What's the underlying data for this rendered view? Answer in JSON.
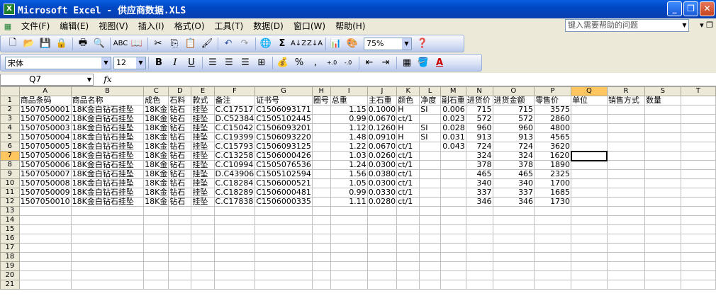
{
  "window": {
    "title": "Microsoft Excel - 供应商数据.XLS",
    "app_icon": "excel-icon"
  },
  "menu": {
    "items": [
      "文件(F)",
      "编辑(E)",
      "视图(V)",
      "插入(I)",
      "格式(O)",
      "工具(T)",
      "数据(D)",
      "窗口(W)",
      "帮助(H)"
    ],
    "help_placeholder": "键入需要帮助的问题"
  },
  "toolbar": {
    "zoom": "75%",
    "font_name": "宋体",
    "font_size": "12",
    "bold": "B",
    "italic": "I",
    "underline": "U",
    "percent": "%",
    "comma": ",",
    "inc_decimal": ".0→.00",
    "dec_decimal": ".00→.0",
    "sigma": "Σ"
  },
  "formula_bar": {
    "name_box": "Q7",
    "fx": "fx",
    "formula": ""
  },
  "sheet": {
    "columns": [
      {
        "letter": "A",
        "w": 73
      },
      {
        "letter": "B",
        "w": 104
      },
      {
        "letter": "C",
        "w": 32
      },
      {
        "letter": "D",
        "w": 33
      },
      {
        "letter": "E",
        "w": 33
      },
      {
        "letter": "F",
        "w": 54
      },
      {
        "letter": "G",
        "w": 54
      },
      {
        "letter": "H",
        "w": 26
      },
      {
        "letter": "I",
        "w": 55
      },
      {
        "letter": "J",
        "w": 40
      },
      {
        "letter": "K",
        "w": 33
      },
      {
        "letter": "L",
        "w": 30
      },
      {
        "letter": "M",
        "w": 35
      },
      {
        "letter": "N",
        "w": 38
      },
      {
        "letter": "O",
        "w": 60
      },
      {
        "letter": "P",
        "w": 54
      },
      {
        "letter": "Q",
        "w": 54
      },
      {
        "letter": "R",
        "w": 54
      },
      {
        "letter": "S",
        "w": 54
      },
      {
        "letter": "T",
        "w": 54
      }
    ],
    "active_column": "Q",
    "active_row": 7,
    "rows": [
      [
        "商品条码",
        "商品名称",
        "成色",
        "石料",
        "款式",
        "备注",
        "证书号",
        "圈号",
        "总重",
        "主石重",
        "颜色",
        "净度",
        "副石重",
        "进货价",
        "进货金额",
        "零售价",
        "单位",
        "销售方式",
        "数量",
        ""
      ],
      [
        "1507050001",
        "18K金白钻石挂坠",
        "18K金",
        "钻石",
        "挂坠",
        "C.C17517",
        "C1506093171",
        "",
        "1.15",
        "0.1000",
        "H",
        "SI",
        "0.006",
        "715",
        "715",
        "3575",
        "",
        "",
        "",
        ""
      ],
      [
        "1507050002",
        "18K金白钻石挂坠",
        "18K金",
        "钻石",
        "挂坠",
        "D.C52384",
        "C1505102445",
        "",
        "0.99",
        "0.0670",
        "ct/1",
        "",
        "0.023",
        "572",
        "572",
        "2860",
        "",
        "",
        "",
        ""
      ],
      [
        "1507050003",
        "18K金白钻石挂坠",
        "18K金",
        "钻石",
        "挂坠",
        "C.C15042",
        "C1506093201",
        "",
        "1.12",
        "0.1260",
        "H",
        "SI",
        "0.028",
        "960",
        "960",
        "4800",
        "",
        "",
        "",
        ""
      ],
      [
        "1507050004",
        "18K金白钻石挂坠",
        "18K金",
        "钻石",
        "挂坠",
        "C.C19399",
        "C1506093220",
        "",
        "1.48",
        "0.0910",
        "H",
        "SI",
        "0.031",
        "913",
        "913",
        "4565",
        "",
        "",
        "",
        ""
      ],
      [
        "1507050005",
        "18K金白钻石挂坠",
        "18K金",
        "钻石",
        "挂坠",
        "C.C15793",
        "C1506093125",
        "",
        "1.22",
        "0.0670",
        "ct/1",
        "",
        "0.043",
        "724",
        "724",
        "3620",
        "",
        "",
        "",
        ""
      ],
      [
        "1507050006",
        "18K金白钻石挂坠",
        "18K金",
        "钻石",
        "挂坠",
        "C.C13258",
        "C1506000426",
        "",
        "1.03",
        "0.0260",
        "ct/1",
        "",
        "",
        "324",
        "324",
        "1620",
        "",
        "",
        "",
        ""
      ],
      [
        "1507050006",
        "18K金白钻石挂坠",
        "18K金",
        "钻石",
        "挂坠",
        "C.C10994",
        "C1505076536",
        "",
        "1.24",
        "0.0300",
        "ct/1",
        "",
        "",
        "378",
        "378",
        "1890",
        "",
        "",
        "",
        ""
      ],
      [
        "1507050007",
        "18K金白钻石挂坠",
        "18K金",
        "钻石",
        "挂坠",
        "D.C43906",
        "C1505102594",
        "",
        "1.56",
        "0.0380",
        "ct/1",
        "",
        "",
        "465",
        "465",
        "2325",
        "",
        "",
        "",
        ""
      ],
      [
        "1507050008",
        "18K金白钻石挂坠",
        "18K金",
        "钻石",
        "挂坠",
        "C.C18284",
        "C1506000521",
        "",
        "1.05",
        "0.0300",
        "ct/1",
        "",
        "",
        "340",
        "340",
        "1700",
        "",
        "",
        "",
        ""
      ],
      [
        "1507050009",
        "18K金白钻石挂坠",
        "18K金",
        "钻石",
        "挂坠",
        "C.C18289",
        "C1506000481",
        "",
        "0.99",
        "0.0330",
        "ct/1",
        "",
        "",
        "337",
        "337",
        "1685",
        "",
        "",
        "",
        ""
      ],
      [
        "1507050010",
        "18K金白钻石挂坠",
        "18K金",
        "钻石",
        "挂坠",
        "C.C17838",
        "C1506000335",
        "",
        "1.11",
        "0.0280",
        "ct/1",
        "",
        "",
        "346",
        "346",
        "1730",
        "",
        "",
        "",
        ""
      ]
    ],
    "numeric_columns": [
      8,
      9,
      12,
      13,
      14,
      15
    ],
    "total_rows": 21
  }
}
